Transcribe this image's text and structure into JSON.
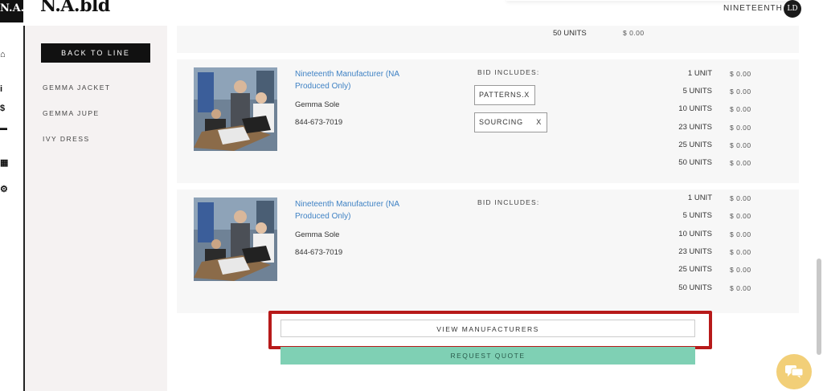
{
  "header": {
    "logo_box": "N.A.",
    "brand": "N.A.bld",
    "user_name": "NINETEENTH",
    "avatar_initials": "LD"
  },
  "rail": {
    "icons": [
      "home-icon",
      "info-icon",
      "dollar-icon",
      "card-icon",
      "grid-icon",
      "gear-icon"
    ],
    "glyphs": [
      "⌂",
      "i",
      "$",
      "▬",
      "▦",
      "⚙"
    ]
  },
  "sidebar": {
    "back_label": "BACK TO LINE",
    "items": [
      {
        "label": "GEMMA JACKET"
      },
      {
        "label": "GEMMA JUPE"
      },
      {
        "label": "IVY DRESS"
      }
    ]
  },
  "partial_card": {
    "units": "50 UNITS",
    "price": "$ 0.00"
  },
  "bids": [
    {
      "manufacturer": "Nineteenth Manufacturer (NA Produced Only)",
      "contact_name": "Gemma Sole",
      "phone": "844-673-7019",
      "bid_includes_label": "BID INCLUDES:",
      "tags": [
        {
          "label": "PATTERNS.",
          "remove": "X"
        },
        {
          "label": "SOURCING",
          "remove": "X"
        }
      ],
      "tiers": [
        {
          "units": "1 UNIT",
          "price": "$ 0.00"
        },
        {
          "units": "5 UNITS",
          "price": "$ 0.00"
        },
        {
          "units": "10 UNITS",
          "price": "$ 0.00"
        },
        {
          "units": "23 UNITS",
          "price": "$ 0.00"
        },
        {
          "units": "25 UNITS",
          "price": "$ 0.00"
        },
        {
          "units": "50 UNITS",
          "price": "$ 0.00"
        }
      ]
    },
    {
      "manufacturer": "Nineteenth Manufacturer (NA Produced Only)",
      "contact_name": "Gemma Sole",
      "phone": "844-673-7019",
      "bid_includes_label": "BID INCLUDES:",
      "tags": [],
      "tiers": [
        {
          "units": "1 UNIT",
          "price": "$ 0.00"
        },
        {
          "units": "5 UNITS",
          "price": "$ 0.00"
        },
        {
          "units": "10 UNITS",
          "price": "$ 0.00"
        },
        {
          "units": "23 UNITS",
          "price": "$ 0.00"
        },
        {
          "units": "25 UNITS",
          "price": "$ 0.00"
        },
        {
          "units": "50 UNITS",
          "price": "$ 0.00"
        }
      ]
    }
  ],
  "actions": {
    "view_manufacturers": "VIEW MANUFACTURERS",
    "request_quote": "REQUEST QUOTE"
  },
  "colors": {
    "link": "#3f82c4",
    "quote_button": "#7fd0b4",
    "highlight": "#b71a1a",
    "chat_bubble": "#f2cf78"
  }
}
